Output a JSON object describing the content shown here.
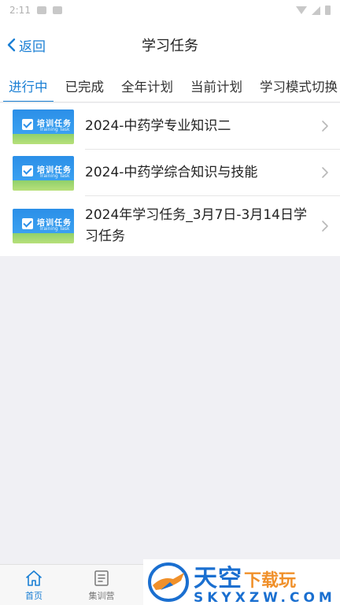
{
  "status_bar": {
    "time": "2:11"
  },
  "header": {
    "back_label": "返回",
    "title": "学习任务"
  },
  "tabs": [
    {
      "label": "进行中",
      "active": true
    },
    {
      "label": "已完成",
      "active": false
    },
    {
      "label": "全年计划",
      "active": false
    },
    {
      "label": "当前计划",
      "active": false
    },
    {
      "label": "学习模式切换",
      "active": false
    }
  ],
  "tasks": [
    {
      "title": "2024-中药学专业知识二",
      "thumb_title": "培训任务",
      "thumb_sub": "Training Task"
    },
    {
      "title": "2024-中药学综合知识与技能",
      "thumb_title": "培训任务",
      "thumb_sub": "Training Task"
    },
    {
      "title": "2024年学习任务_3月7日-3月14日学习任务",
      "thumb_title": "培训任务",
      "thumb_sub": "Training Task"
    }
  ],
  "bottom_nav": [
    {
      "label": "首页",
      "icon": "home-icon",
      "active": true
    },
    {
      "label": "集训营",
      "icon": "clipboard-icon",
      "active": false
    }
  ],
  "watermark": {
    "main": "天空",
    "accent": "下载玩",
    "sub": "SKYXZW.COM"
  },
  "colors": {
    "accent": "#1a7fd4",
    "background": "#f0f0f4"
  }
}
